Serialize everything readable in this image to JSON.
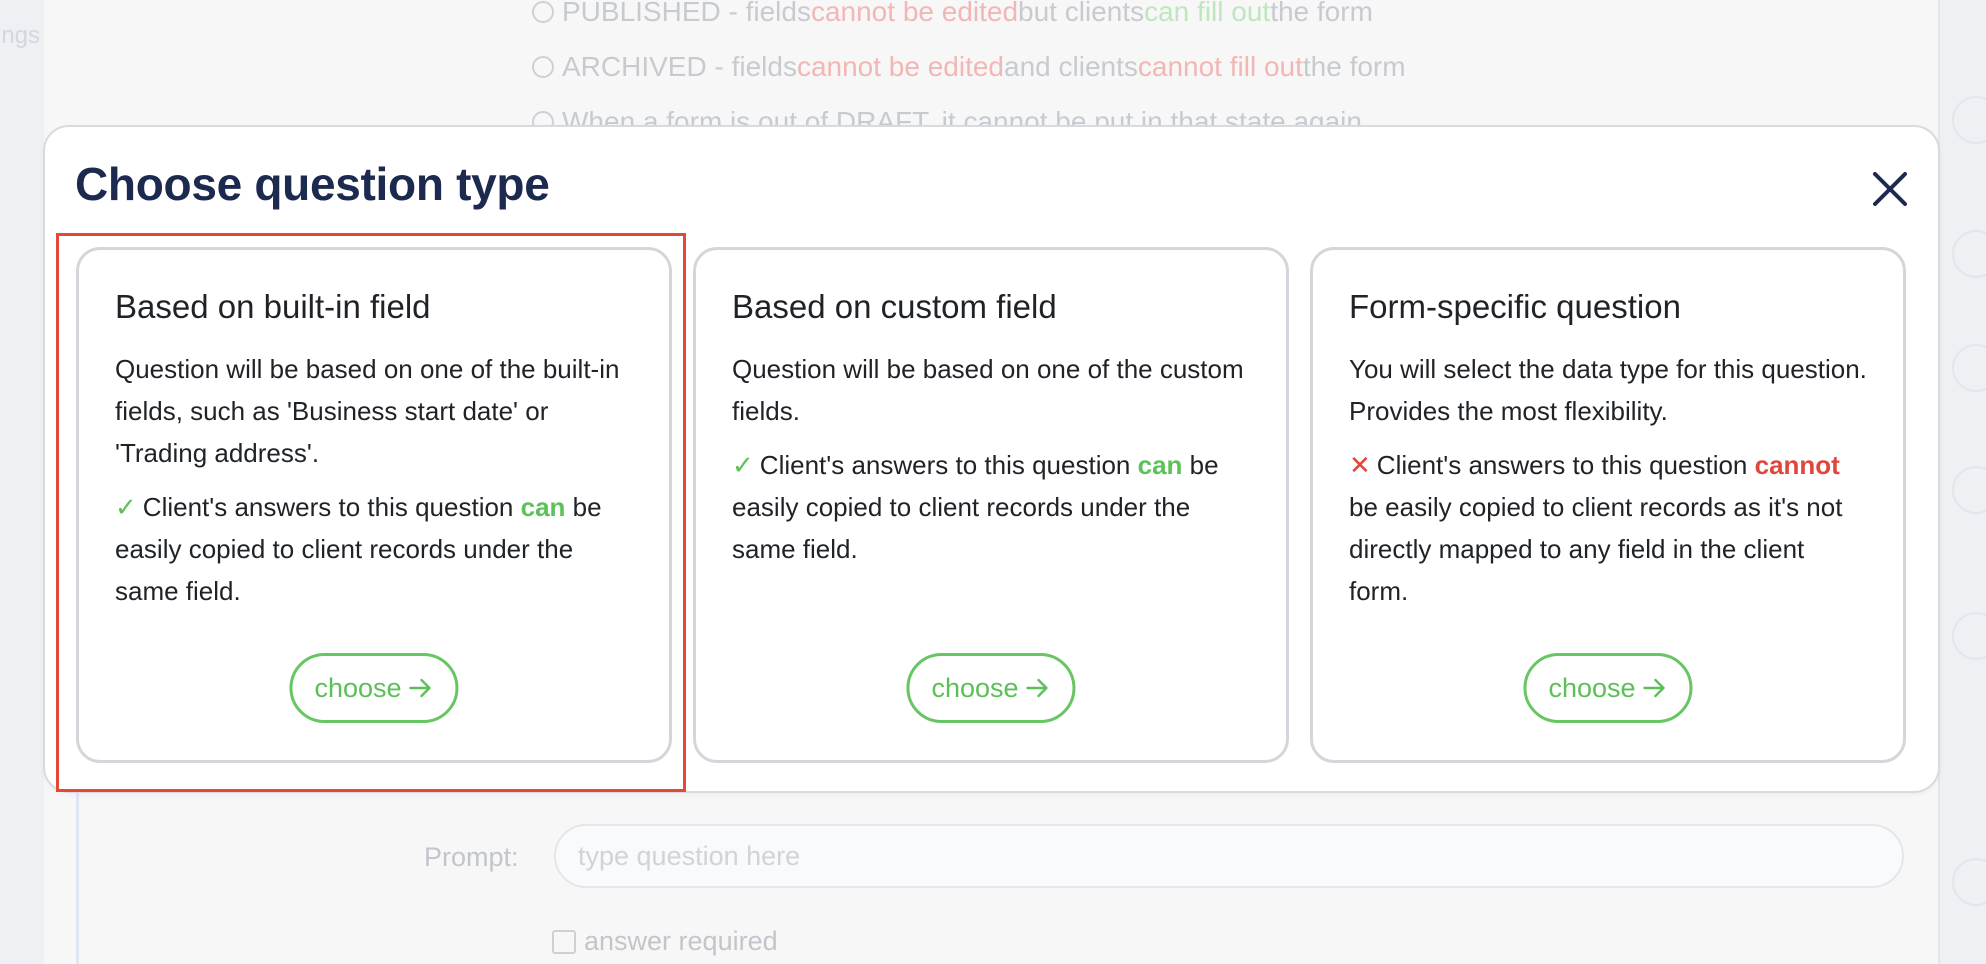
{
  "background": {
    "sidebar_fragment": "ings",
    "status_options": [
      {
        "label": "PUBLISHED - fields ",
        "restriction": "cannot be edited",
        "middle": " but clients ",
        "permission": "can fill out",
        "end": " the form"
      },
      {
        "label": "ARCHIVED - fields ",
        "restriction": "cannot be edited",
        "middle": " and clients ",
        "permission": "cannot fill out",
        "end": " the form"
      }
    ],
    "notice": "When a form is out of DRAFT, it cannot be put in that state again",
    "prompt_label": "Prompt:",
    "prompt_placeholder": "type question here",
    "answer_required_label": "answer required"
  },
  "modal": {
    "title": "Choose question type",
    "close_icon": "close-icon",
    "cards": [
      {
        "title": "Based on built-in field",
        "description": "Question will be based on one of the built-in fields, such as 'Business start date' or 'Trading address'.",
        "note_mark": "✓",
        "note_before": "Client's answers to this question ",
        "note_keyword": "can",
        "note_after": " be easily copied to client records under the same field.",
        "button_label": "choose",
        "selected": true
      },
      {
        "title": "Based on custom field",
        "description": "Question will be based on one of the custom fields.",
        "note_mark": "✓",
        "note_before": "Client's answers to this question ",
        "note_keyword": "can",
        "note_after": " be easily copied to client records under the same field.",
        "button_label": "choose",
        "selected": false
      },
      {
        "title": "Form-specific question",
        "description": "You will select the data type for this question. Provides the most flexibility.",
        "note_mark": "✕",
        "note_before": "Client's answers to this question ",
        "note_keyword": "cannot",
        "note_after": " be easily copied to client records as it's not directly mapped to any field in the client form.",
        "button_label": "choose",
        "selected": false
      }
    ]
  },
  "colors": {
    "title": "#1c2a4f",
    "positive": "#5cc158",
    "negative": "#e0473c",
    "highlight": "#e14a37",
    "card_border": "#d3d7dc"
  }
}
